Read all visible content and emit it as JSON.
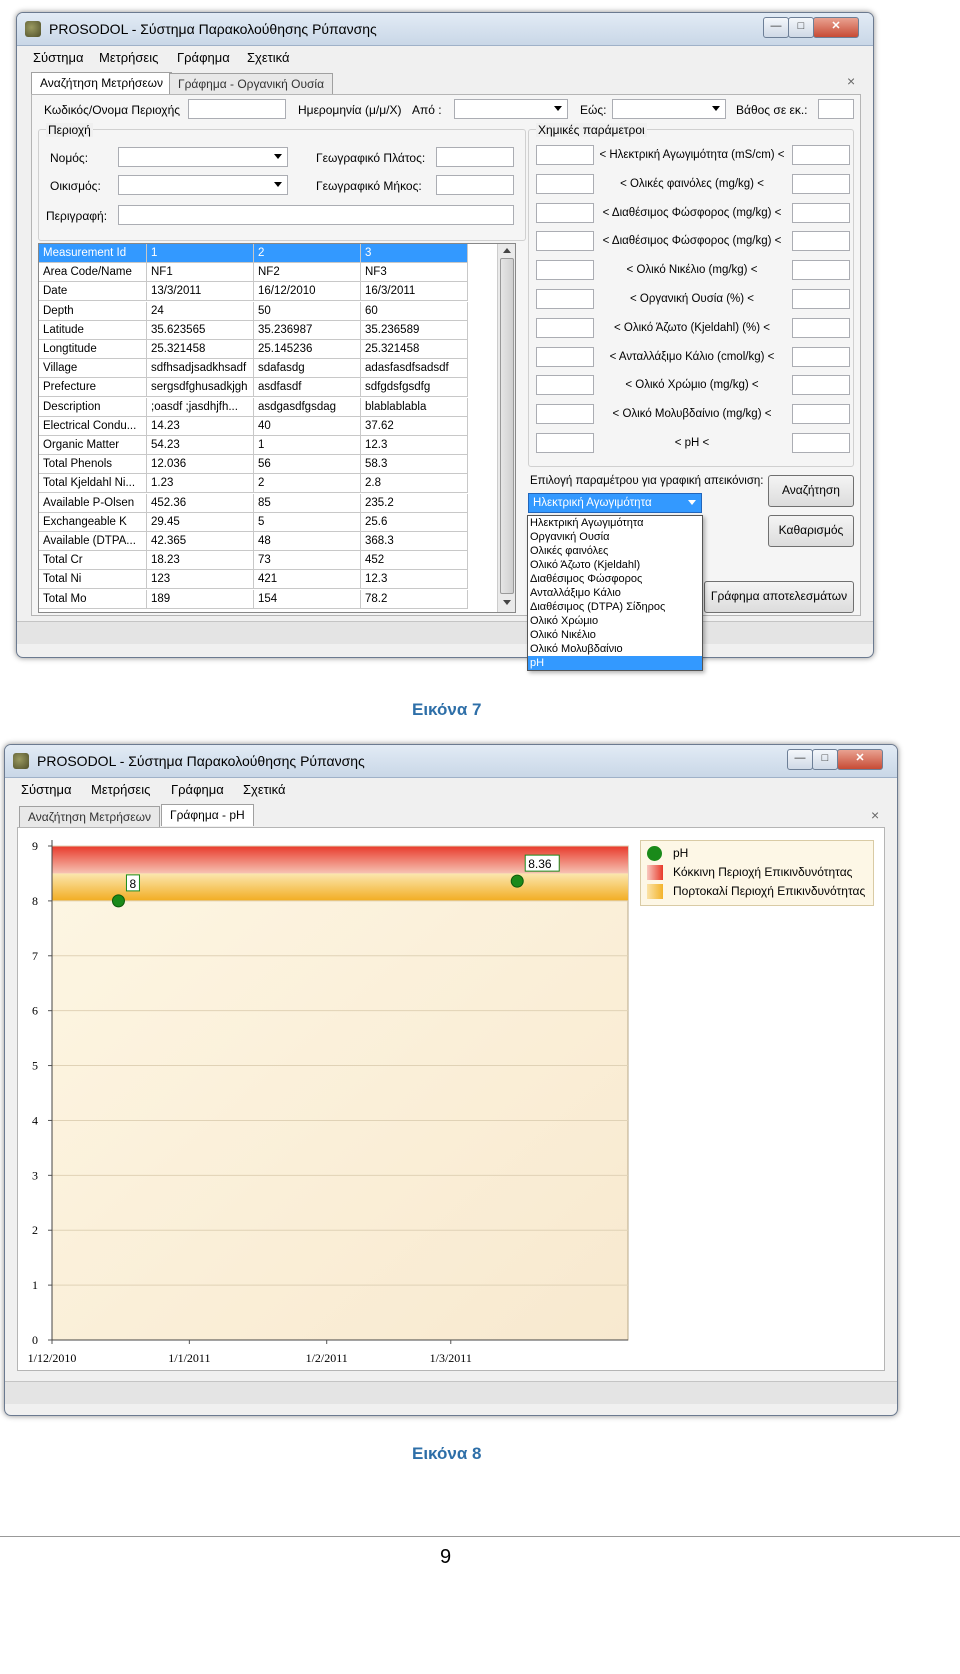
{
  "window_title": "PROSODOL - Σύστημα Παρακολούθησης Ρύπανσης",
  "window_buttons": {
    "minimize": "—",
    "maximize": "□",
    "close": "✕"
  },
  "menu": [
    "Σύστημα",
    "Μετρήσεις",
    "Γράφημα",
    "Σχετικά"
  ],
  "tab_close": "×",
  "screen1": {
    "tabs": [
      "Αναζήτηση Μετρήσεων",
      "Γράφημα - Οργανική Ουσία"
    ],
    "labels": {
      "area_code": "Κωδικός/Ονομα Περιοχής",
      "date": "Ημερομηνία (μ/μ/Χ)",
      "from": "Από :",
      "to": "Εώς:",
      "depth": "Βάθος σε εκ.:",
      "area_group": "Περιοχή",
      "prefecture": "Νομός:",
      "settlement": "Οικισμός:",
      "description": "Περιγραφή:",
      "latitude": "Γεωγραφικό Πλάτος:",
      "longitude": "Γεωγραφικό Μήκος:",
      "chem_group": "Χημικές παράμετροι",
      "param_select": "Επιλογή παραμέτρου για γραφική απεικόνιση:"
    },
    "chem_params": [
      "< Ηλεκτρική Αγωγιμότητα (mS/cm) <",
      "< Ολικές φαινόλες (mg/kg) <",
      "< Διαθέσιμος Φώσφορος (mg/kg) <",
      "< Διαθέσιμος Φώσφορος (mg/kg) <",
      "< Ολικό Νικέλιο (mg/kg) <",
      "< Οργανική Ουσία (%) <",
      "< Ολικό Άζωτο (Kjeldahl) (%) <",
      "< Ανταλλάξιμο Κάλιο (cmol/kg) <",
      "< Ολικό Χρώμιο (mg/kg) <",
      "< Ολικό Μολυβδαίνιο (mg/kg) <",
      "< pH <"
    ],
    "grid": {
      "header": [
        "Measurement Id",
        "1",
        "2",
        "3"
      ],
      "rows": [
        [
          "Area Code/Name",
          "NF1",
          "NF2",
          "NF3"
        ],
        [
          "Date",
          "13/3/2011",
          "16/12/2010",
          "16/3/2011"
        ],
        [
          "Depth",
          "24",
          "50",
          "60"
        ],
        [
          "Latitude",
          "35.623565",
          "35.236987",
          "35.236589"
        ],
        [
          "Longtitude",
          "25.321458",
          "25.145236",
          "25.321458"
        ],
        [
          "Village",
          "sdfhsadjsadkhsadf",
          "sdafasdg",
          "adasfasdfsadsdf"
        ],
        [
          "Prefecture",
          "sergsdfghusadkjgh",
          "asdfasdf",
          "sdfgdsfgsdfg"
        ],
        [
          "Description",
          ";oasdf ;jasdhjfh...",
          "asdgasdfgsdag",
          "blablablabla"
        ],
        [
          "Electrical Condu...",
          "14.23",
          "40",
          "37.62"
        ],
        [
          "Organic Matter",
          "54.23",
          "1",
          "12.3"
        ],
        [
          "Total Phenols",
          "12.036",
          "56",
          "58.3"
        ],
        [
          "Total Kjeldahl Ni...",
          "1.23",
          "2",
          "2.8"
        ],
        [
          "Available P-Olsen",
          "452.36",
          "85",
          "235.2"
        ],
        [
          "Exchangeable K",
          "29.45",
          "5",
          "25.6"
        ],
        [
          "Available (DTPA...",
          "42.365",
          "48",
          "368.3"
        ],
        [
          "Total Cr",
          "18.23",
          "73",
          "452"
        ],
        [
          "Total Ni",
          "123",
          "421",
          "12.3"
        ],
        [
          "Total Mo",
          "189",
          "154",
          "78.2"
        ]
      ]
    },
    "selected_param": "Ηλεκτρική Αγωγιμότητα",
    "dropdown_options": [
      "Ηλεκτρική Αγωγιμότητα",
      "Οργανική Ουσία",
      "Ολικές φαινόλες",
      "Ολικό Άζωτο (Kjeldahl)",
      "Διαθέσιμος Φώσφορος",
      "Ανταλλάξιμο Κάλιο",
      "Διαθέσιμος (DTPA) Σίδηρος",
      "Ολικό Χρώμιο",
      "Ολικό Νικέλιο",
      "Ολικό Μολυβδαίνιο",
      "pH"
    ],
    "dropdown_highlighted": 10,
    "buttons": {
      "search": "Αναζήτηση",
      "clear": "Καθαρισμός",
      "results_chart": "Γράφημα αποτελεσμάτων"
    }
  },
  "caption1": "Εικόνα 7",
  "screen2": {
    "tabs": [
      "Αναζήτηση Μετρήσεων",
      "Γράφημα - pH"
    ],
    "legend": [
      "pH",
      "Κόκκινη Περιοχή Επικινδυνότητας",
      "Πορτοκαλί Περιοχή Επικινδυνότητας"
    ]
  },
  "chart_data": {
    "type": "scatter",
    "x_tick_labels": [
      "1/12/2010",
      "1/1/2011",
      "1/2/2011",
      "1/3/2011"
    ],
    "y_ticks": [
      "0",
      "1",
      "2",
      "3",
      "4",
      "5",
      "6",
      "7",
      "8",
      "9"
    ],
    "ylim": [
      0,
      9
    ],
    "xlim": [
      "2010-12-01",
      "2011-04-10"
    ],
    "series": [
      {
        "name": "pH",
        "color": "#1a8a1a",
        "points": [
          {
            "x": "2010-12-16",
            "y": 8,
            "label": "8"
          },
          {
            "x": "2011-03-16",
            "y": 8.36,
            "label": "8.36"
          }
        ]
      }
    ],
    "bands": [
      {
        "name": "Κόκκινη Περιοχή Επικινδυνότητας",
        "from": 8.5,
        "to": 9,
        "color": "#e83a2a"
      },
      {
        "name": "Πορτοκαλί Περιοχή Επικινδυνότητας",
        "from": 8,
        "to": 8.5,
        "color": "#f3b32a"
      }
    ],
    "grid": true,
    "legend_position": "top-right"
  },
  "caption2": "Εικόνα 8",
  "page_number": "9"
}
